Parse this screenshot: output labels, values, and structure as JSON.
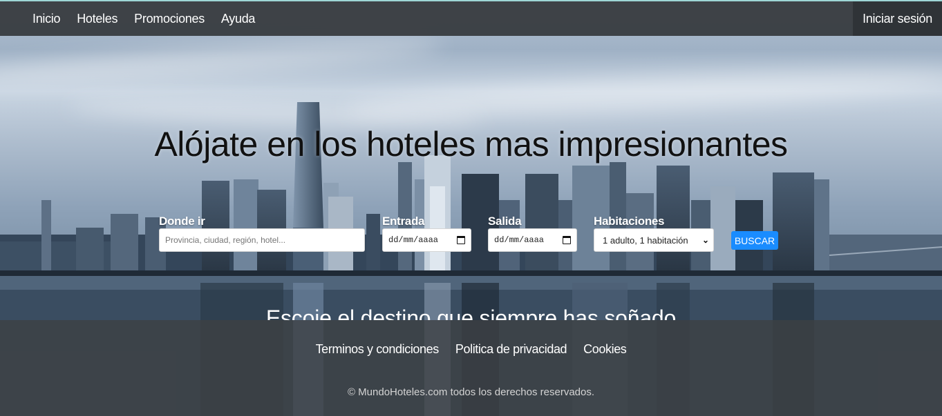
{
  "navbar": {
    "links": [
      {
        "label": "Inicio"
      },
      {
        "label": "Hoteles"
      },
      {
        "label": "Promociones"
      },
      {
        "label": "Ayuda"
      }
    ],
    "login_label": "Iniciar sesión"
  },
  "hero": {
    "title": "Alójate en los hoteles mas impresionantes"
  },
  "search": {
    "destination": {
      "label": "Donde ir",
      "placeholder": "Provincia, ciudad, región, hotel...",
      "value": ""
    },
    "checkin": {
      "label": "Entrada",
      "value": "dd/mm/aaaa",
      "icon": "calendar-icon"
    },
    "checkout": {
      "label": "Salida",
      "value": "dd/mm/aaaa",
      "icon": "calendar-icon"
    },
    "rooms": {
      "label": "Habitaciones",
      "value": "1 adulto, 1 habitación",
      "icon": "chevron-down-icon"
    },
    "button_label": "BUSCAR",
    "button_color": "#1a8cff"
  },
  "tagline": "Escoje el destino que siempre has soñado",
  "footer": {
    "links": [
      {
        "label": "Terminos y condiciones"
      },
      {
        "label": "Politica de privacidad"
      },
      {
        "label": "Cookies"
      }
    ],
    "copyright": "© MundoHoteles.com todos los derechos reservados."
  }
}
